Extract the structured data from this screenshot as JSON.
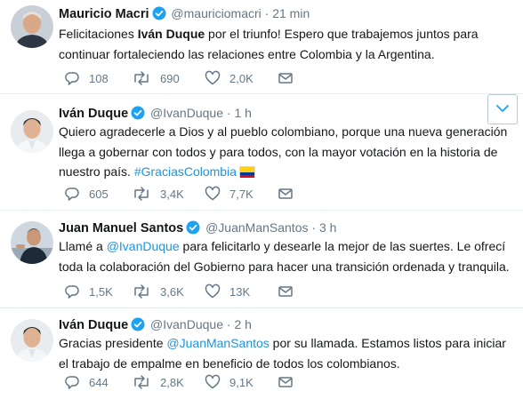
{
  "tweets": [
    {
      "name": "Mauricio Macri",
      "handle": "@mauriciomacri",
      "separator": "·",
      "time": "21 min",
      "text": [
        {
          "t": "Felicitaciones "
        },
        {
          "t": "Iván Duque",
          "style": "bold"
        },
        {
          "t": " por el triunfo! Espero que trabajemos juntos para continuar fortaleciendo las relaciones entre Colombia y la Argentina."
        }
      ],
      "replies": "108",
      "retweets": "690",
      "likes": "2,0K"
    },
    {
      "name": "Iván Duque",
      "handle": "@IvanDuque",
      "separator": "·",
      "time": "1 h",
      "text": [
        {
          "t": "Quiero agradecerle a Dios y al pueblo colombiano, porque una nueva generación llega a gobernar con todos y para todos, con la mayor votación en la historia de nuestro país. "
        },
        {
          "t": "#GraciasColombia",
          "style": "link"
        }
      ],
      "has_flag": true,
      "replies": "605",
      "retweets": "3,4K",
      "likes": "7,7K",
      "more_icon": "chevron-down-icon"
    },
    {
      "name": "Juan Manuel Santos",
      "handle": "@JuanManSantos",
      "separator": "·",
      "time": "3 h",
      "text": [
        {
          "t": "Llamé a "
        },
        {
          "t": "@IvanDuque",
          "style": "link"
        },
        {
          "t": " para felicitarlo y desearle la mejor de las suertes. Le ofrecí toda la colaboración del Gobierno para hacer una transición ordenada y tranquila."
        }
      ],
      "replies": "1,5K",
      "retweets": "3,6K",
      "likes": "13K"
    },
    {
      "name": "Iván Duque",
      "handle": "@IvanDuque",
      "separator": "·",
      "time": "2 h",
      "text": [
        {
          "t": "Gracias presidente "
        },
        {
          "t": "@JuanManSantos",
          "style": "link"
        },
        {
          "t": " por su llamada. Estamos listos para iniciar el trabajo de empalme en beneficio de todos los colombianos."
        }
      ],
      "replies": "644",
      "retweets": "2,8K",
      "likes": "9,1K"
    }
  ],
  "colors": {
    "verified": "#1da1f2",
    "link": "#1b95e0",
    "icon_gray": "#657786"
  },
  "icons": {
    "reply": "reply-icon",
    "retweet": "retweet-icon",
    "like": "heart-icon",
    "message": "envelope-icon",
    "verified": "verified-badge-icon"
  }
}
